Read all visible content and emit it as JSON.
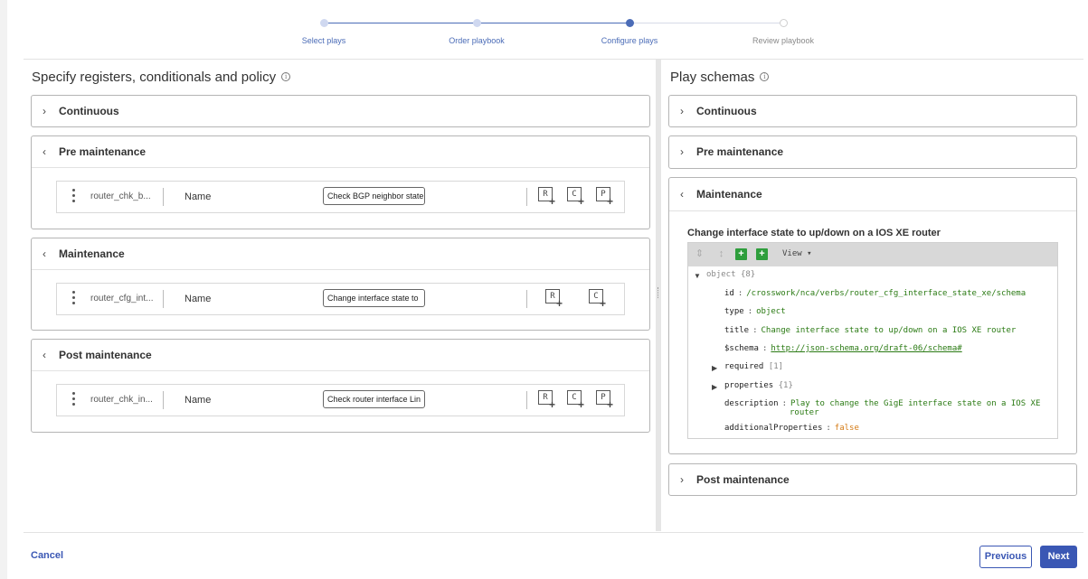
{
  "stepper": {
    "steps": [
      {
        "label": "Select plays",
        "state": "done"
      },
      {
        "label": "Order playbook",
        "state": "done"
      },
      {
        "label": "Configure plays",
        "state": "current"
      },
      {
        "label": "Review playbook",
        "state": "upcoming"
      }
    ],
    "colors": {
      "active": "#4b6cb7",
      "inactive": "#cfd8f0"
    }
  },
  "left_panel": {
    "title": "Specify registers, conditionals and policy",
    "info_glyph": "i",
    "sections": [
      {
        "label": "Continuous",
        "expanded": false
      },
      {
        "label": "Pre maintenance",
        "expanded": true,
        "play": {
          "id": "router_chk_b...",
          "name_label": "Name",
          "name_value": "Check BGP neighbor state",
          "buttons": [
            "R",
            "C",
            "P"
          ]
        }
      },
      {
        "label": "Maintenance",
        "expanded": true,
        "play": {
          "id": "router_cfg_int...",
          "name_label": "Name",
          "name_value": "Change interface state to",
          "buttons": [
            "R",
            "C"
          ]
        }
      },
      {
        "label": "Post maintenance",
        "expanded": true,
        "play": {
          "id": "router_chk_in...",
          "name_label": "Name",
          "name_value": "Check router interface Lin",
          "buttons": [
            "R",
            "C",
            "P"
          ]
        }
      }
    ]
  },
  "right_panel": {
    "title": "Play schemas",
    "info_glyph": "i",
    "sections": [
      {
        "label": "Continuous",
        "expanded": false
      },
      {
        "label": "Pre maintenance",
        "expanded": false
      },
      {
        "label": "Maintenance",
        "expanded": true
      },
      {
        "label": "Post maintenance",
        "expanded": false
      }
    ],
    "schema": {
      "title": "Change interface state to up/down on a IOS XE router",
      "toolbar": {
        "view_label": "View ▾"
      },
      "root": {
        "key": "object",
        "meta": "{8}"
      },
      "fields": {
        "id": {
          "key": "id",
          "value": "/crosswork/nca/verbs/router_cfg_interface_state_xe/schema"
        },
        "type": {
          "key": "type",
          "value": "object"
        },
        "title": {
          "key": "title",
          "value": "Change interface state to up/down on a IOS XE router"
        },
        "schema": {
          "key": "$schema",
          "value": "http://json-schema.org/draft-06/schema#"
        },
        "required": {
          "key": "required",
          "meta": "[1]"
        },
        "properties": {
          "key": "properties",
          "meta": "{1}"
        },
        "description": {
          "key": "description",
          "value_line1": "Play to change the GigE interface state on a IOS XE",
          "value_line2": "router"
        },
        "additional": {
          "key": "additionalProperties",
          "value": "false"
        }
      }
    }
  },
  "footer": {
    "cancel": "Cancel",
    "previous": "Previous",
    "next": "Next"
  },
  "colors": {
    "accent": "#3a57b4",
    "json_string": "#2a7a13",
    "json_bool": "#d47a14",
    "tool_green": "#2e9e3c"
  }
}
